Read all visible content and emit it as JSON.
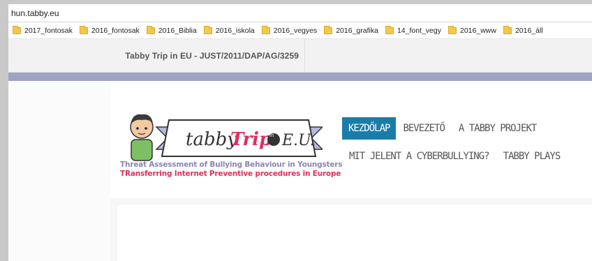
{
  "browser": {
    "url": "hun.tabby.eu",
    "bookmarks": [
      {
        "label": "2017_fontosak"
      },
      {
        "label": "2016_fontosak"
      },
      {
        "label": "2016_Biblia"
      },
      {
        "label": "2016_iskola"
      },
      {
        "label": "2016_vegyes"
      },
      {
        "label": "2016_grafika"
      },
      {
        "label": "14_font_vegy"
      },
      {
        "label": "2016_www"
      },
      {
        "label": "2016_áll"
      }
    ]
  },
  "site": {
    "top_title": "Tabby Trip in EU - JUST/2011/DAP/AG/3259",
    "logo": {
      "wordmark_left": "tabby",
      "wordmark_trip": "Trip",
      "wordmark_in": "in",
      "wordmark_eu": "E.U.",
      "tagline_1": "Threat Assessment of Bullying Behaviour in Youngsters",
      "tagline_2": "TRansferring Internet Preventive procedures in Europe"
    },
    "nav": {
      "row1": [
        {
          "label": "KEZDŐLAP",
          "active": true
        },
        {
          "label": "BEVEZETŐ",
          "active": false
        },
        {
          "label": "A TABBY PROJEKT",
          "active": false
        }
      ],
      "row2": [
        {
          "label": "MIT JELENT A CYBERBULLYING?",
          "active": false
        },
        {
          "label": "TABBY PLAYS",
          "active": false
        }
      ]
    },
    "colors": {
      "nav_active_bg": "#1a7ca8",
      "band": "#a0a3c4",
      "tagline_1": "#8a85b8",
      "tagline_2": "#d9325e"
    }
  }
}
